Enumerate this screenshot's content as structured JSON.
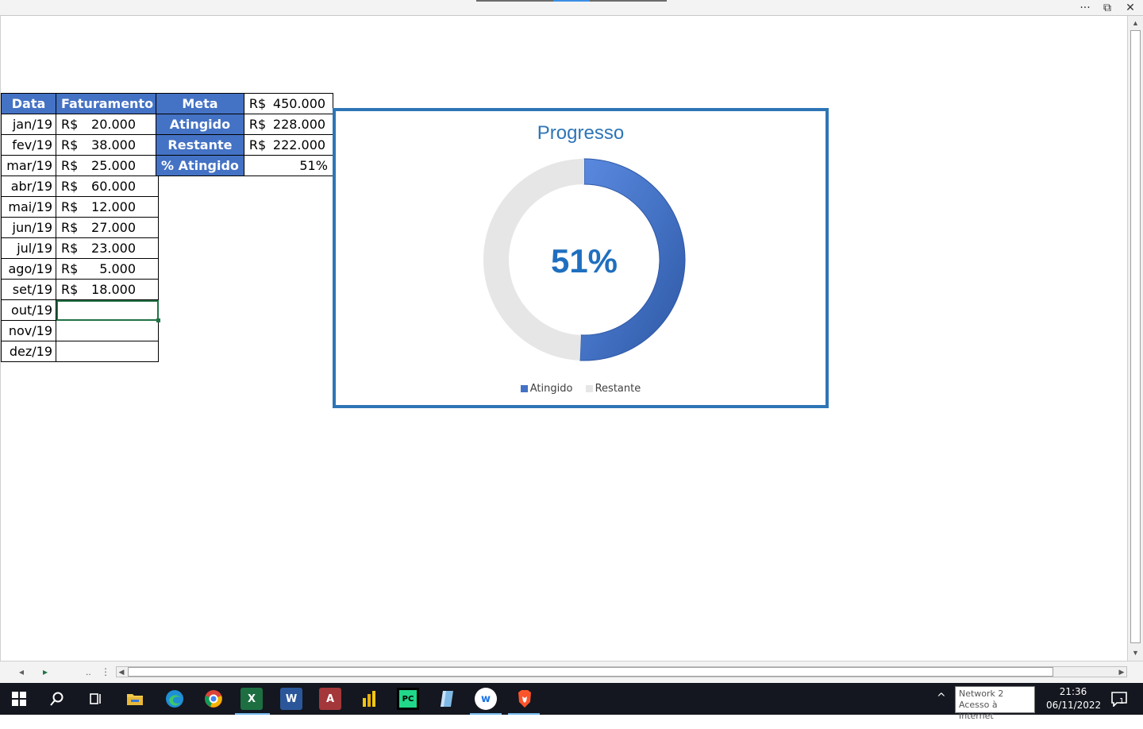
{
  "window": {
    "more_label": "···",
    "restore_label": "⧉",
    "close_label": "✕"
  },
  "sales_table": {
    "headers": [
      "Data",
      "Faturamento"
    ],
    "currency": "R$",
    "rows": [
      {
        "date": "jan/19",
        "value": "20.000"
      },
      {
        "date": "fev/19",
        "value": "38.000"
      },
      {
        "date": "mar/19",
        "value": "25.000"
      },
      {
        "date": "abr/19",
        "value": "60.000"
      },
      {
        "date": "mai/19",
        "value": "12.000"
      },
      {
        "date": "jun/19",
        "value": "27.000"
      },
      {
        "date": "jul/19",
        "value": "23.000"
      },
      {
        "date": "ago/19",
        "value": "5.000"
      },
      {
        "date": "set/19",
        "value": "18.000"
      },
      {
        "date": "out/19",
        "value": ""
      },
      {
        "date": "nov/19",
        "value": ""
      },
      {
        "date": "dez/19",
        "value": ""
      }
    ],
    "selected_row": 9
  },
  "summary_table": {
    "rows": [
      {
        "label": "Meta",
        "currency": "R$",
        "value": "450.000"
      },
      {
        "label": "Atingido",
        "currency": "R$",
        "value": "228.000"
      },
      {
        "label": "Restante",
        "currency": "R$",
        "value": "222.000"
      },
      {
        "label": "% Atingido",
        "currency": "",
        "value": "51%"
      }
    ]
  },
  "chart_data": {
    "type": "pie",
    "subtype": "doughnut",
    "title": "Progresso",
    "center_label": "51%",
    "categories": [
      "Atingido",
      "Restante"
    ],
    "values": [
      228000,
      222000
    ],
    "colors": [
      "#4472c4",
      "#e7e6e6"
    ],
    "legend": "bottom"
  },
  "bottom_bar": {
    "prev_sheet": "◂",
    "next_sheet": "▸",
    "more_sheets": "..",
    "divider": "⋮"
  },
  "taskbar": {
    "start_icon": "windows-logo",
    "apps": [
      {
        "name": "search-icon",
        "glyph": "⌕"
      },
      {
        "name": "task-view-icon",
        "glyph": "▤"
      },
      {
        "name": "file-explorer-icon",
        "glyph": ""
      },
      {
        "name": "edge-icon",
        "glyph": ""
      },
      {
        "name": "chrome-icon",
        "glyph": ""
      },
      {
        "name": "excel-icon",
        "glyph": "X"
      },
      {
        "name": "word-icon",
        "glyph": "W"
      },
      {
        "name": "access-icon",
        "glyph": "A"
      },
      {
        "name": "power-bi-icon",
        "glyph": ""
      },
      {
        "name": "pycharm-icon",
        "glyph": "PC"
      },
      {
        "name": "app-icon",
        "glyph": ""
      },
      {
        "name": "wps-icon",
        "glyph": "w"
      },
      {
        "name": "brave-icon",
        "glyph": ""
      }
    ],
    "tray_chevron": "^",
    "network_tooltip": {
      "line1": "Network 2",
      "line2": "Acesso à Internet"
    },
    "clock": {
      "time": "21:36",
      "date": "06/11/2022"
    },
    "notifications_count": "1"
  }
}
